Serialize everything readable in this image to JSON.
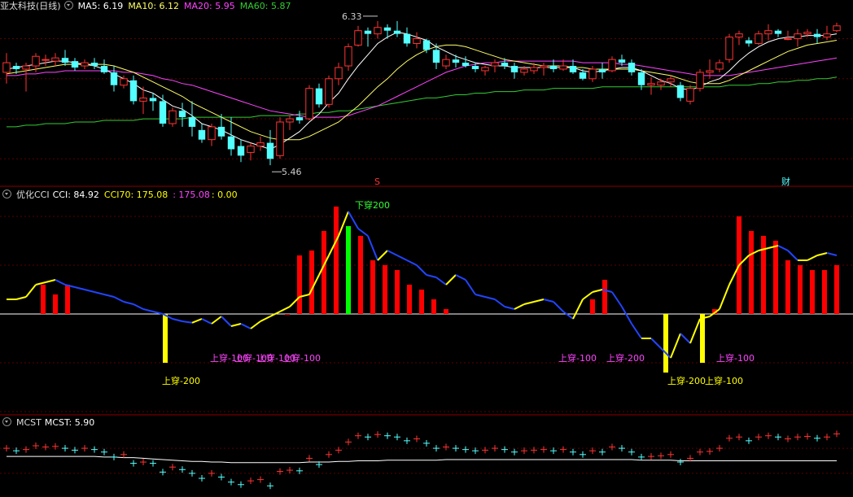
{
  "colors": {
    "bg": "#000000",
    "divider": "#8b0000",
    "grid": "#5a0000",
    "up": "#ff3333",
    "down": "#54ffff",
    "ma5": "#ffffff",
    "ma10": "#ffff66",
    "ma20": "#ff44ff",
    "ma60": "#33cc33",
    "cci_up": "#ffff00",
    "cci_down": "#2244ff",
    "label_pink": "#ff44ff",
    "label_yellow": "#ffff00",
    "bar_red": "#ff0000",
    "bar_yellow": "#ffff00",
    "bar_green": "#00ff00"
  },
  "price_panel": {
    "stock_name": "亚太科技(日线)",
    "toggle_icon": "circle-down-icon",
    "ma5": {
      "label": "MA5: 6.19"
    },
    "ma10": {
      "label": "MA10: 6.12"
    },
    "ma20": {
      "label": "MA20: 5.95"
    },
    "ma60": {
      "label": "MA60: 5.87"
    },
    "high_label": "6.33",
    "low_label": "5.46",
    "marker_s": "S",
    "marker_cai": "财"
  },
  "cci_panel": {
    "name": "优化CCI",
    "cci_label": "CCI: 84.92",
    "cci70_label": "CCI70: 175.08",
    "v3_label": ": 175.08",
    "v4_label": ": 0.00",
    "top_label": "下穿200",
    "cross_labels": [
      "上穿-200",
      "上穿-100",
      "上穿-100",
      "上穿-100",
      "上穿-100",
      "上穿-100",
      "上穿-200",
      "上穿-200",
      "上穿-100"
    ]
  },
  "mcst_panel": {
    "name": "MCST",
    "value_label": "MCST: 5.90"
  },
  "chart_data": {
    "type": "candlestick",
    "candles": [
      [
        6.04,
        6.16,
        5.97,
        6.1
      ],
      [
        6.08,
        6.1,
        6.03,
        6.06
      ],
      [
        6.06,
        6.1,
        5.92,
        6.08
      ],
      [
        6.08,
        6.16,
        6.04,
        6.14
      ],
      [
        6.12,
        6.15,
        6.08,
        6.12
      ],
      [
        6.11,
        6.16,
        6.08,
        6.13
      ],
      [
        6.13,
        6.18,
        6.08,
        6.1
      ],
      [
        6.11,
        6.13,
        6.05,
        6.07
      ],
      [
        6.08,
        6.12,
        6.06,
        6.1
      ],
      [
        6.1,
        6.13,
        6.06,
        6.08
      ],
      [
        6.08,
        6.12,
        6.03,
        6.04
      ],
      [
        6.04,
        6.08,
        5.92,
        5.96
      ],
      [
        5.96,
        6.02,
        5.94,
        6.0
      ],
      [
        5.99,
        6.02,
        5.84,
        5.86
      ],
      [
        5.86,
        5.95,
        5.78,
        5.88
      ],
      [
        5.88,
        5.91,
        5.8,
        5.86
      ],
      [
        5.86,
        5.9,
        5.7,
        5.72
      ],
      [
        5.72,
        5.82,
        5.7,
        5.8
      ],
      [
        5.8,
        5.85,
        5.7,
        5.76
      ],
      [
        5.76,
        5.86,
        5.64,
        5.7
      ],
      [
        5.68,
        5.72,
        5.6,
        5.62
      ],
      [
        5.62,
        5.72,
        5.58,
        5.7
      ],
      [
        5.7,
        5.78,
        5.62,
        5.64
      ],
      [
        5.64,
        5.76,
        5.52,
        5.56
      ],
      [
        5.58,
        5.62,
        5.48,
        5.52
      ],
      [
        5.54,
        5.6,
        5.49,
        5.58
      ],
      [
        5.58,
        5.64,
        5.55,
        5.6
      ],
      [
        5.6,
        5.68,
        5.46,
        5.5
      ],
      [
        5.52,
        5.76,
        5.5,
        5.73
      ],
      [
        5.73,
        5.77,
        5.68,
        5.75
      ],
      [
        5.76,
        5.8,
        5.72,
        5.74
      ],
      [
        5.75,
        5.96,
        5.74,
        5.94
      ],
      [
        5.94,
        5.97,
        5.82,
        5.84
      ],
      [
        5.84,
        6.02,
        5.82,
        6.0
      ],
      [
        6.0,
        6.1,
        5.96,
        6.07
      ],
      [
        6.08,
        6.22,
        6.05,
        6.2
      ],
      [
        6.21,
        6.33,
        6.2,
        6.3
      ],
      [
        6.3,
        6.32,
        6.2,
        6.28
      ],
      [
        6.28,
        6.36,
        6.25,
        6.32
      ],
      [
        6.32,
        6.34,
        6.25,
        6.3
      ],
      [
        6.3,
        6.36,
        6.26,
        6.28
      ],
      [
        6.28,
        6.32,
        6.2,
        6.22
      ],
      [
        6.22,
        6.29,
        6.19,
        6.25
      ],
      [
        6.24,
        6.25,
        6.16,
        6.18
      ],
      [
        6.18,
        6.22,
        6.06,
        6.1
      ],
      [
        6.08,
        6.15,
        6.06,
        6.12
      ],
      [
        6.12,
        6.15,
        6.07,
        6.1
      ],
      [
        6.1,
        6.14,
        6.07,
        6.08
      ],
      [
        6.08,
        6.1,
        6.04,
        6.06
      ],
      [
        6.05,
        6.08,
        6.02,
        6.07
      ],
      [
        6.08,
        6.12,
        6.04,
        6.1
      ],
      [
        6.1,
        6.13,
        6.06,
        6.08
      ],
      [
        6.08,
        6.1,
        6.0,
        6.04
      ],
      [
        6.04,
        6.08,
        6.02,
        6.06
      ],
      [
        6.05,
        6.1,
        6.03,
        6.07
      ],
      [
        6.07,
        6.1,
        6.02,
        6.08
      ],
      [
        6.08,
        6.12,
        6.04,
        6.06
      ],
      [
        6.06,
        6.12,
        6.05,
        6.08
      ],
      [
        6.08,
        6.12,
        6.03,
        6.04
      ],
      [
        6.04,
        6.06,
        5.99,
        6.0
      ],
      [
        6.0,
        6.08,
        5.98,
        6.06
      ],
      [
        6.06,
        6.1,
        6.0,
        6.04
      ],
      [
        6.05,
        6.14,
        6.04,
        6.12
      ],
      [
        6.12,
        6.15,
        6.08,
        6.1
      ],
      [
        6.1,
        6.12,
        6.02,
        6.04
      ],
      [
        6.04,
        6.06,
        5.93,
        5.96
      ],
      [
        5.96,
        6.01,
        5.9,
        5.97
      ],
      [
        5.96,
        6.0,
        5.93,
        5.98
      ],
      [
        5.98,
        6.02,
        5.95,
        6.0
      ],
      [
        5.96,
        5.98,
        5.86,
        5.88
      ],
      [
        5.86,
        5.96,
        5.84,
        5.94
      ],
      [
        5.94,
        6.06,
        5.92,
        6.04
      ],
      [
        6.04,
        6.12,
        6.0,
        6.05
      ],
      [
        6.06,
        6.12,
        6.04,
        6.1
      ],
      [
        6.12,
        6.28,
        6.1,
        6.26
      ],
      [
        6.26,
        6.3,
        6.21,
        6.28
      ],
      [
        6.24,
        6.26,
        6.2,
        6.22
      ],
      [
        6.22,
        6.3,
        6.21,
        6.28
      ],
      [
        6.28,
        6.34,
        6.24,
        6.3
      ],
      [
        6.3,
        6.31,
        6.26,
        6.28
      ],
      [
        6.25,
        6.3,
        6.24,
        6.25
      ],
      [
        6.25,
        6.31,
        6.2,
        6.28
      ],
      [
        6.28,
        6.31,
        6.26,
        6.29
      ],
      [
        6.28,
        6.31,
        6.22,
        6.26
      ],
      [
        6.26,
        6.33,
        6.24,
        6.28
      ],
      [
        6.3,
        6.35,
        6.29,
        6.33
      ]
    ],
    "ma5": [
      6.06,
      6.07,
      6.08,
      6.09,
      6.1,
      6.11,
      6.11,
      6.1,
      6.09,
      6.08,
      6.06,
      6.03,
      6.0,
      5.97,
      5.93,
      5.91,
      5.87,
      5.83,
      5.81,
      5.77,
      5.72,
      5.7,
      5.68,
      5.65,
      5.62,
      5.6,
      5.58,
      5.56,
      5.59,
      5.63,
      5.67,
      5.73,
      5.78,
      5.85,
      5.91,
      6.0,
      6.08,
      6.15,
      6.22,
      6.26,
      6.29,
      6.28,
      6.26,
      6.24,
      6.2,
      6.17,
      6.14,
      6.12,
      6.1,
      6.09,
      6.08,
      6.08,
      6.07,
      6.07,
      6.07,
      6.07,
      6.07,
      6.07,
      6.07,
      6.05,
      6.04,
      6.05,
      6.06,
      6.07,
      6.07,
      6.05,
      6.02,
      5.99,
      5.97,
      5.94,
      5.93,
      5.95,
      5.98,
      6.0,
      6.05,
      6.11,
      6.16,
      6.2,
      6.23,
      6.25,
      6.26,
      6.26,
      6.27,
      6.27,
      6.27,
      6.28
    ],
    "ma10": [
      6.03,
      6.04,
      6.05,
      6.06,
      6.07,
      6.08,
      6.09,
      6.09,
      6.09,
      6.09,
      6.09,
      6.08,
      6.06,
      6.04,
      6.01,
      5.98,
      5.95,
      5.92,
      5.89,
      5.85,
      5.82,
      5.79,
      5.76,
      5.73,
      5.7,
      5.67,
      5.65,
      5.63,
      5.62,
      5.62,
      5.62,
      5.64,
      5.67,
      5.7,
      5.73,
      5.78,
      5.83,
      5.89,
      5.95,
      6.0,
      6.06,
      6.11,
      6.15,
      6.18,
      6.2,
      6.21,
      6.21,
      6.2,
      6.18,
      6.16,
      6.14,
      6.12,
      6.11,
      6.1,
      6.09,
      6.08,
      6.08,
      6.08,
      6.07,
      6.07,
      6.06,
      6.06,
      6.06,
      6.06,
      6.06,
      6.05,
      6.04,
      6.03,
      6.02,
      6.0,
      5.98,
      5.97,
      5.97,
      5.97,
      5.99,
      6.02,
      6.05,
      6.08,
      6.11,
      6.14,
      6.17,
      6.19,
      6.21,
      6.22,
      6.23,
      6.24
    ],
    "ma20": [
      6.02,
      6.02,
      6.03,
      6.03,
      6.04,
      6.04,
      6.05,
      6.05,
      6.05,
      6.05,
      6.05,
      6.05,
      6.04,
      6.04,
      6.03,
      6.02,
      6.0,
      5.99,
      5.97,
      5.96,
      5.94,
      5.92,
      5.9,
      5.88,
      5.86,
      5.84,
      5.82,
      5.8,
      5.79,
      5.78,
      5.77,
      5.76,
      5.76,
      5.76,
      5.76,
      5.77,
      5.79,
      5.81,
      5.83,
      5.86,
      5.89,
      5.92,
      5.95,
      5.98,
      6.01,
      6.04,
      6.06,
      6.08,
      6.09,
      6.1,
      6.1,
      6.11,
      6.11,
      6.11,
      6.11,
      6.11,
      6.11,
      6.11,
      6.11,
      6.1,
      6.1,
      6.1,
      6.1,
      6.09,
      6.09,
      6.08,
      6.07,
      6.06,
      6.05,
      6.04,
      6.03,
      6.02,
      6.02,
      6.02,
      6.02,
      6.03,
      6.04,
      6.05,
      6.06,
      6.07,
      6.08,
      6.09,
      6.1,
      6.11,
      6.12,
      6.13
    ],
    "ma60": [
      5.7,
      5.7,
      5.71,
      5.71,
      5.72,
      5.72,
      5.72,
      5.73,
      5.73,
      5.73,
      5.74,
      5.74,
      5.74,
      5.74,
      5.75,
      5.75,
      5.75,
      5.75,
      5.75,
      5.76,
      5.76,
      5.76,
      5.76,
      5.76,
      5.76,
      5.76,
      5.77,
      5.77,
      5.77,
      5.77,
      5.78,
      5.78,
      5.79,
      5.79,
      5.8,
      5.8,
      5.81,
      5.82,
      5.83,
      5.84,
      5.85,
      5.86,
      5.87,
      5.88,
      5.88,
      5.89,
      5.9,
      5.9,
      5.91,
      5.91,
      5.92,
      5.92,
      5.92,
      5.93,
      5.93,
      5.93,
      5.94,
      5.94,
      5.94,
      5.94,
      5.94,
      5.95,
      5.95,
      5.95,
      5.95,
      5.95,
      5.95,
      5.95,
      5.95,
      5.95,
      5.95,
      5.95,
      5.95,
      5.95,
      5.96,
      5.96,
      5.96,
      5.97,
      5.97,
      5.98,
      5.98,
      5.99,
      5.99,
      6.0,
      6.0,
      6.01
    ],
    "cci": [
      30,
      30,
      35,
      60,
      65,
      70,
      60,
      55,
      50,
      45,
      40,
      35,
      25,
      20,
      10,
      5,
      0,
      -10,
      -15,
      -18,
      -10,
      -20,
      -5,
      -25,
      -20,
      -30,
      -15,
      -5,
      5,
      15,
      35,
      40,
      80,
      120,
      160,
      210,
      175,
      160,
      110,
      130,
      120,
      110,
      100,
      80,
      75,
      60,
      80,
      70,
      40,
      35,
      30,
      15,
      10,
      20,
      25,
      30,
      25,
      5,
      -10,
      30,
      45,
      50,
      45,
      15,
      -20,
      -50,
      -50,
      -70,
      -90,
      -40,
      -60,
      -10,
      -5,
      10,
      60,
      100,
      120,
      130,
      135,
      140,
      130,
      110,
      110,
      120,
      125,
      120
    ],
    "cci_bars": [
      [
        3,
        60,
        "r"
      ],
      [
        4,
        40,
        "r"
      ],
      [
        5,
        60,
        "r"
      ],
      [
        13,
        -100,
        "y"
      ],
      [
        23,
        0,
        "r"
      ],
      [
        24,
        120,
        "r"
      ],
      [
        25,
        130,
        "r"
      ],
      [
        26,
        170,
        "r"
      ],
      [
        27,
        220,
        "r"
      ],
      [
        28,
        180,
        "g"
      ],
      [
        29,
        160,
        "r"
      ],
      [
        30,
        110,
        "r"
      ],
      [
        31,
        100,
        "r"
      ],
      [
        32,
        90,
        "r"
      ],
      [
        33,
        60,
        "r"
      ],
      [
        34,
        50,
        "r"
      ],
      [
        35,
        30,
        "r"
      ],
      [
        36,
        10,
        "r"
      ],
      [
        48,
        30,
        "r"
      ],
      [
        49,
        70,
        "r"
      ],
      [
        54,
        -120,
        "y"
      ],
      [
        57,
        -100,
        "y"
      ],
      [
        58,
        10,
        "r"
      ],
      [
        60,
        200,
        "r"
      ],
      [
        61,
        170,
        "r"
      ],
      [
        62,
        160,
        "r"
      ],
      [
        63,
        150,
        "r"
      ],
      [
        64,
        110,
        "r"
      ],
      [
        65,
        100,
        "r"
      ],
      [
        66,
        90,
        "r"
      ],
      [
        67,
        90,
        "r"
      ],
      [
        68,
        100,
        "r"
      ]
    ],
    "mcst": [
      5.97,
      5.97,
      5.97,
      5.97,
      5.97,
      5.97,
      5.97,
      5.97,
      5.97,
      5.97,
      5.96,
      5.96,
      5.95,
      5.95,
      5.94,
      5.93,
      5.92,
      5.91,
      5.9,
      5.89,
      5.89,
      5.88,
      5.88,
      5.87,
      5.87,
      5.87,
      5.87,
      5.87,
      5.87,
      5.87,
      5.87,
      5.88,
      5.88,
      5.88,
      5.89,
      5.89,
      5.9,
      5.9,
      5.9,
      5.91,
      5.91,
      5.91,
      5.91,
      5.91,
      5.91,
      5.92,
      5.92,
      5.92,
      5.92,
      5.92,
      5.92,
      5.92,
      5.92,
      5.92,
      5.92,
      5.92,
      5.92,
      5.92,
      5.92,
      5.92,
      5.92,
      5.92,
      5.92,
      5.92,
      5.92,
      5.91,
      5.91,
      5.91,
      5.91,
      5.9,
      5.9,
      5.9,
      5.9,
      5.9,
      5.9,
      5.9,
      5.9,
      5.9,
      5.9,
      5.9,
      5.9,
      5.9,
      5.9,
      5.9,
      5.9,
      5.9
    ]
  }
}
